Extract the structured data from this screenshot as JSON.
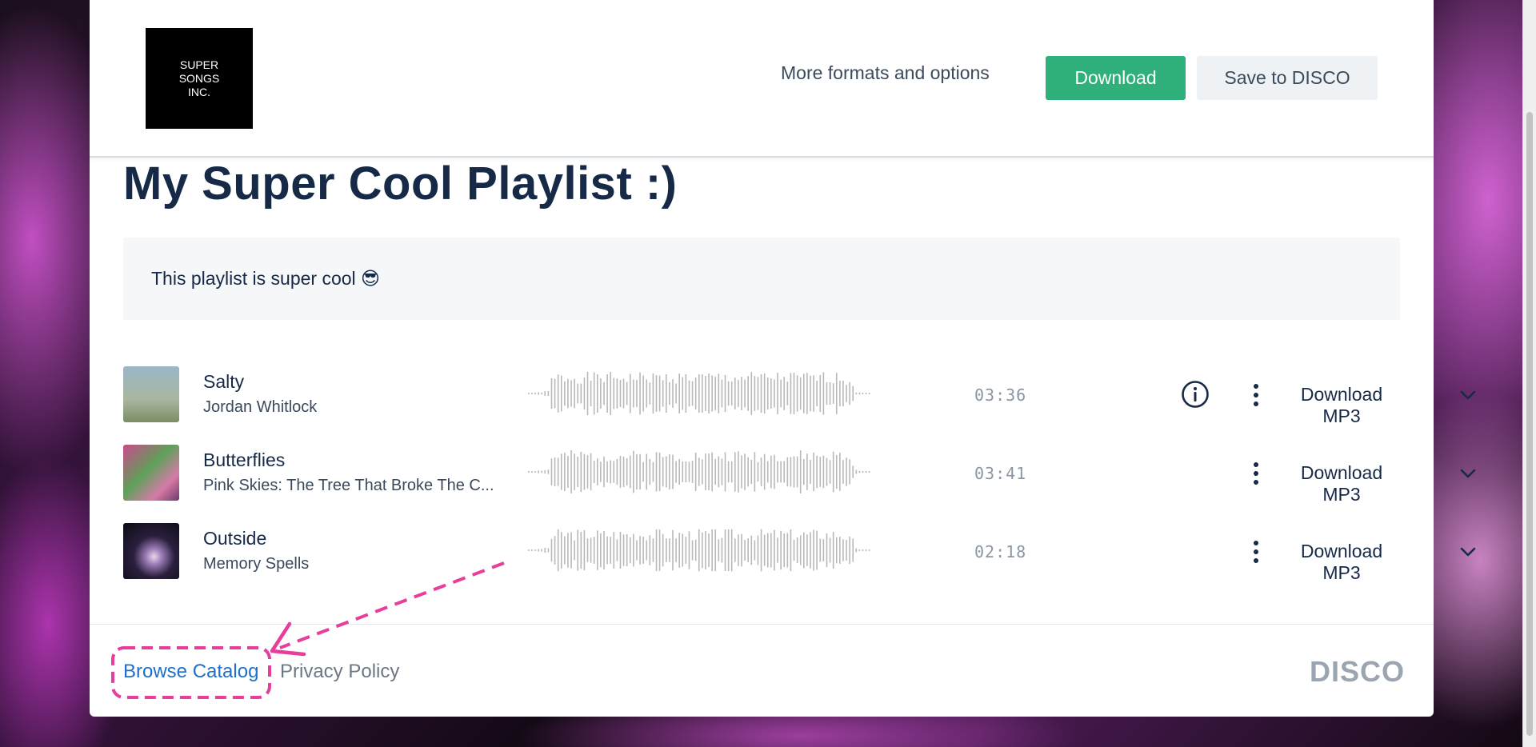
{
  "header": {
    "logo_text": "SUPER\nSONGS\nINC.",
    "more_formats_label": "More formats and options",
    "download_label": "Download",
    "save_label": "Save to DISCO"
  },
  "playlist": {
    "title": "My Super Cool Playlist :)",
    "description": "This playlist is super cool 😎"
  },
  "tracks": [
    {
      "title": "Salty",
      "artist": "Jordan Whitlock",
      "duration": "03:36",
      "download_label": "Download MP3"
    },
    {
      "title": "Butterflies",
      "artist": "Pink Skies: The Tree That Broke The C...",
      "duration": "03:41",
      "download_label": "Download MP3"
    },
    {
      "title": "Outside",
      "artist": "Memory Spells",
      "duration": "02:18",
      "download_label": "Download MP3"
    }
  ],
  "footer": {
    "browse_label": "Browse Catalog",
    "privacy_label": "Privacy Policy",
    "brand": "DISCO"
  },
  "colors": {
    "primary_button": "#2fb07a",
    "link": "#1d6fc9",
    "heading": "#162a47",
    "annotation": "#e83e9b",
    "waveform": "#b8b8b8"
  }
}
